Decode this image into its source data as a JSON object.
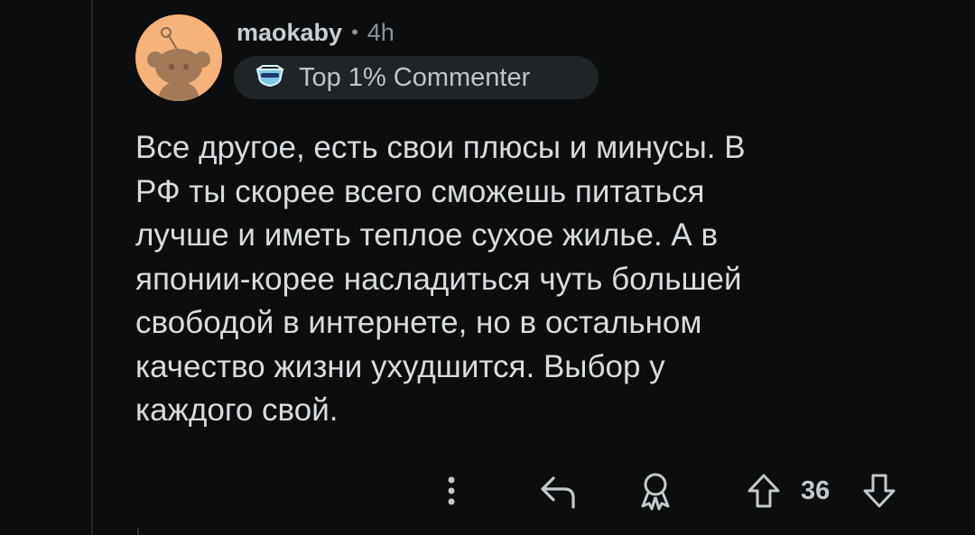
{
  "comment": {
    "author": "maokaby",
    "separator": "•",
    "age": "4h",
    "flair": {
      "text": "Top 1% Commenter",
      "icon": "top-commenter-badge-icon"
    },
    "avatar": {
      "icon": "reddit-snoo-avatar",
      "background": "#f6b379"
    },
    "body": "Все другое, есть свои плюсы и минусы. В\nРФ ты скорее всего сможешь питаться\nлучше и иметь теплое сухое жилье. А в\nяпонии-корее насладиться чуть большей\nсвободой в интернете, но в остальном\nкачество жизни ухудшится. Выбор у\nкаждого свой."
  },
  "actions": {
    "more_icon": "more-vertical-icon",
    "reply_icon": "reply-icon",
    "award_icon": "award-icon",
    "upvote_icon": "upvote-arrow-icon",
    "vote_count": "36",
    "downvote_icon": "downvote-arrow-icon"
  },
  "colors": {
    "background": "#0b0d0f",
    "text": "#d9dcde",
    "muted": "#8a949a",
    "flair_bg": "#1f2427",
    "thread_line": "#24292c"
  }
}
